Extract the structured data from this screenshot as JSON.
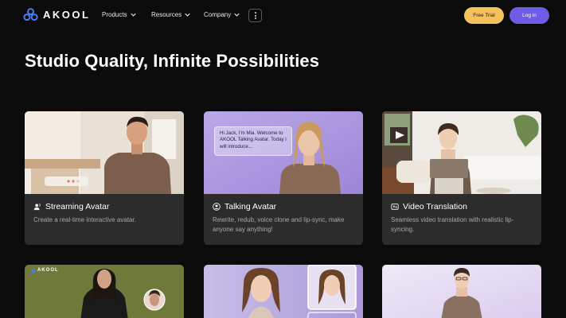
{
  "brand": {
    "name": "AKOOL",
    "accent": "#4a7bf7"
  },
  "nav": {
    "items": [
      {
        "label": "Products"
      },
      {
        "label": "Resources"
      },
      {
        "label": "Company"
      }
    ],
    "free_trial": "Free Trial",
    "login": "Log in"
  },
  "hero": {
    "title": "Studio Quality, Infinite Possibilities"
  },
  "cards": [
    {
      "title": "Streaming Avatar",
      "desc": "Create a real-time interactive avatar.",
      "icon": "streaming-avatar-icon"
    },
    {
      "title": "Talking Avatar",
      "desc": "Rewrite, redub, voice clone and lip-sync, make anyone say anything!",
      "icon": "talking-avatar-icon",
      "bubble": "Hi Jack, I'm Mia. Welcome to AKOOL Talking Avatar. Today i will introduce..."
    },
    {
      "title": "Video Translation",
      "desc": "Seamless video translation with realistic lip-syncing.",
      "icon": "video-translation-icon"
    }
  ],
  "bottom_cards": [
    {
      "watermark": "AKOOL"
    },
    {},
    {}
  ]
}
